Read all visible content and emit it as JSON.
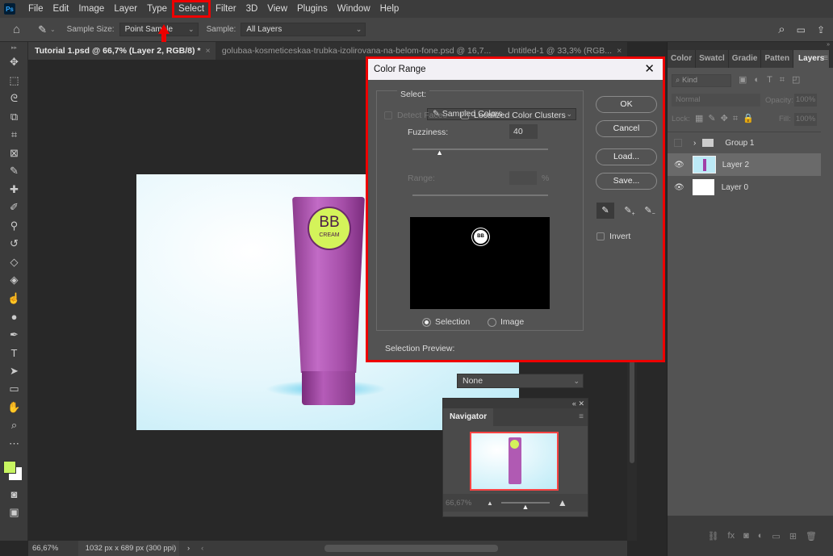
{
  "menu": {
    "items": [
      "File",
      "Edit",
      "Image",
      "Layer",
      "Type",
      "Select",
      "Filter",
      "3D",
      "View",
      "Plugins",
      "Window",
      "Help"
    ],
    "highlighted": "Select"
  },
  "options": {
    "sample_size_label": "Sample Size:",
    "sample_size_value": "Point Sample",
    "sample_label": "Sample:",
    "sample_value": "All Layers"
  },
  "tabs": [
    {
      "label": "Tutorial 1.psd @ 66,7% (Layer 2, RGB/8) *"
    },
    {
      "label": "golubaa-kosmeticeskaa-trubka-izolirovana-na-belom-fone.psd @ 16,7..."
    },
    {
      "label": "Untitled-1 @ 33,3% (RGB..."
    }
  ],
  "canvas": {
    "tube_label_main": "BB",
    "tube_label_sub": "CREAM"
  },
  "status": {
    "zoom": "66,67%",
    "doc_info": "1032 px x 689 px (300 ppi)"
  },
  "dialog": {
    "title": "Color Range",
    "select_label": "Select:",
    "select_value": "Sampled Colors",
    "detect_faces": "Detect Faces",
    "localized": "Localized Color Clusters",
    "fuzziness_label": "Fuzziness:",
    "fuzziness_value": "40",
    "fuzziness_fraction": 0.2,
    "range_label": "Range:",
    "range_unit": "%",
    "view_selection": "Selection",
    "view_image": "Image",
    "view_selected": "Selection",
    "preview_label": "Selection Preview:",
    "preview_value": "None",
    "ok": "OK",
    "cancel": "Cancel",
    "load": "Load...",
    "save": "Save...",
    "invert": "Invert"
  },
  "layers_panel": {
    "tabs": [
      "Color",
      "Swatcl",
      "Gradie",
      "Patten",
      "Layers"
    ],
    "active_tab": "Layers",
    "filter_placeholder": "Kind",
    "blend_mode": "Normal",
    "opacity_label": "Opacity:",
    "opacity": "100%",
    "lock_label": "Lock:",
    "fill_label": "Fill:",
    "fill": "100%",
    "layers": [
      {
        "name": "Group 1",
        "type": "group"
      },
      {
        "name": "Layer 2",
        "selected": true
      },
      {
        "name": "Layer 0"
      }
    ]
  },
  "navigator": {
    "title": "Navigator",
    "zoom": "66,67%",
    "zoom_fraction": 0.5
  },
  "colors": {
    "foreground": "#c8f560",
    "background": "#ffffff",
    "highlight": "#ee0000"
  }
}
